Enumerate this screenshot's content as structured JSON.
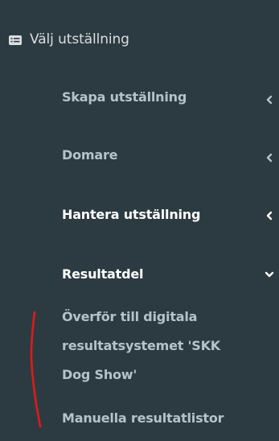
{
  "header": {
    "label": "Välj utställning",
    "icon": "list-card-icon"
  },
  "menu": {
    "items": [
      {
        "label": "Skapa utställning",
        "icon": "chevron-left-icon"
      },
      {
        "label": "Domare",
        "icon": "chevron-left-icon"
      },
      {
        "label": "Hantera utställning",
        "icon": "chevron-left-icon"
      },
      {
        "label": "Resultatdel",
        "icon": "chevron-down-icon"
      }
    ],
    "resultatdel_items": [
      {
        "line1": "Överför till digitala",
        "line2": "resultatsystemet 'SKK",
        "line3": "Dog Show'"
      },
      {
        "label": "Manuella resultatlistor"
      }
    ]
  },
  "colors": {
    "background": "#222d32",
    "submenu_background": "#2c3b41",
    "text_muted": "#b4c3cb",
    "text_active": "#ffffff",
    "annotation": "#e0191c"
  }
}
